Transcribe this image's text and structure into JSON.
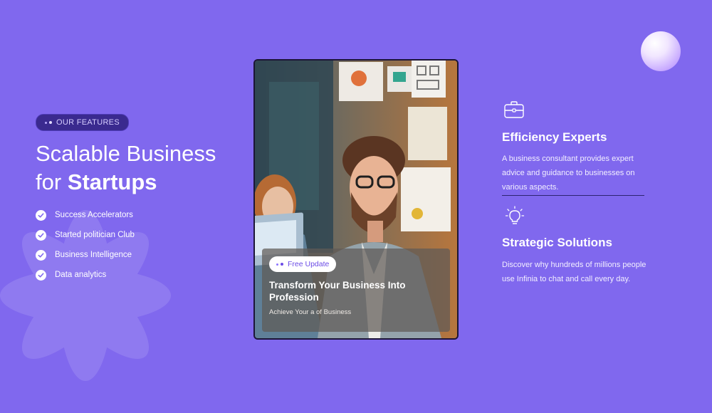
{
  "features_section": {
    "badge_label": "OUR FEATURES",
    "headline_line1": "Scalable Business",
    "headline_prefix": "for ",
    "headline_strong": "Startups",
    "items": [
      {
        "label": "Success Accelerators"
      },
      {
        "label": "Started politician Club"
      },
      {
        "label": "Business Intelligence"
      },
      {
        "label": "Data analytics"
      }
    ]
  },
  "card": {
    "pill_label": "Free Update",
    "title": "Transform Your Business Into Profession",
    "subtitle": "Achieve Your a of Business"
  },
  "services": [
    {
      "icon": "briefcase-icon",
      "title": "Efficiency Experts",
      "text": "A business consultant provides expert advice and guidance to businesses on various aspects."
    },
    {
      "icon": "lightbulb-icon",
      "title": "Strategic Solutions",
      "text": "Discover why hundreds of millions people use Infinia to chat and call every day."
    }
  ],
  "colors": {
    "background": "#8068ee",
    "badge": "#3a2a8f",
    "accent": "#6b4ce6",
    "orb": "#d9c8ff"
  }
}
